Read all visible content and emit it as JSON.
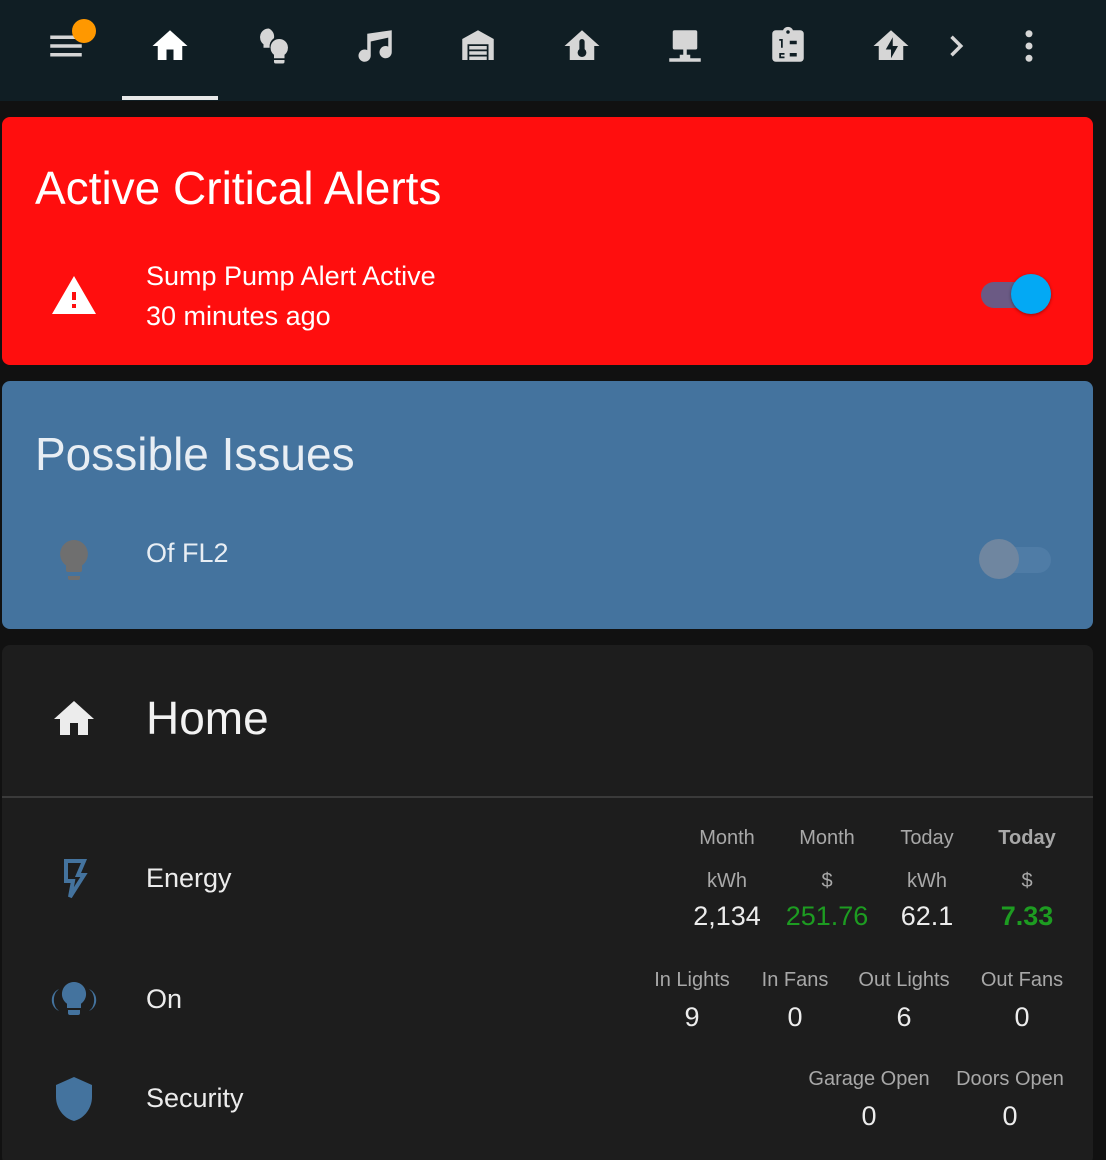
{
  "toolbar": {
    "tabs": [
      {
        "name": "home",
        "icon": "home-icon",
        "active": true
      },
      {
        "name": "lights",
        "icon": "lightbulb-group-icon"
      },
      {
        "name": "music",
        "icon": "music-note-icon"
      },
      {
        "name": "garage",
        "icon": "garage-icon"
      },
      {
        "name": "climate",
        "icon": "home-thermometer-icon"
      },
      {
        "name": "network",
        "icon": "lan-icon"
      },
      {
        "name": "lists",
        "icon": "clipboard-list-icon"
      },
      {
        "name": "energy",
        "icon": "home-lightning-icon"
      }
    ],
    "notification_color": "#ff9800"
  },
  "alerts_card": {
    "title": "Active Critical Alerts",
    "background": "#ff0e0e",
    "item": {
      "icon": "alert-icon",
      "name": "Sump Pump Alert Active",
      "time": "30 minutes ago",
      "state": "on"
    }
  },
  "issues_card": {
    "title": "Possible Issues",
    "background": "#44739e",
    "item": {
      "icon": "lightbulb-icon",
      "name": "Of FL2",
      "state": "off"
    }
  },
  "home_card": {
    "title": "Home",
    "icon": "home-icon",
    "rows": [
      {
        "name": "Energy",
        "icon": "lightning-bolt-icon",
        "attributes": [
          {
            "label1": "Month",
            "label2": "kWh",
            "value": "2,134"
          },
          {
            "label1": "Month",
            "label2": "$",
            "value": "251.76"
          },
          {
            "label1": "Today",
            "label2": "kWh",
            "value": "62.1"
          },
          {
            "label1": "Today",
            "label2": "$",
            "value": "7.33"
          }
        ]
      },
      {
        "name": "On",
        "icon": "lightbulb-group-icon",
        "attributes": [
          {
            "label": "In Lights",
            "value": "9"
          },
          {
            "label": "In Fans",
            "value": "0"
          },
          {
            "label": "Out Lights",
            "value": "6"
          },
          {
            "label": "Out Fans",
            "value": "0"
          }
        ]
      },
      {
        "name": "Security",
        "icon": "shield-icon",
        "attributes": [
          {
            "label": "Garage Open",
            "value": "0"
          },
          {
            "label": "Doors Open",
            "value": "0"
          }
        ]
      }
    ]
  },
  "colors": {
    "accent": "#03a9f4",
    "positive": "#1d9c21",
    "icon_blue": "#44739e",
    "card_bg": "#1d1d1d"
  }
}
